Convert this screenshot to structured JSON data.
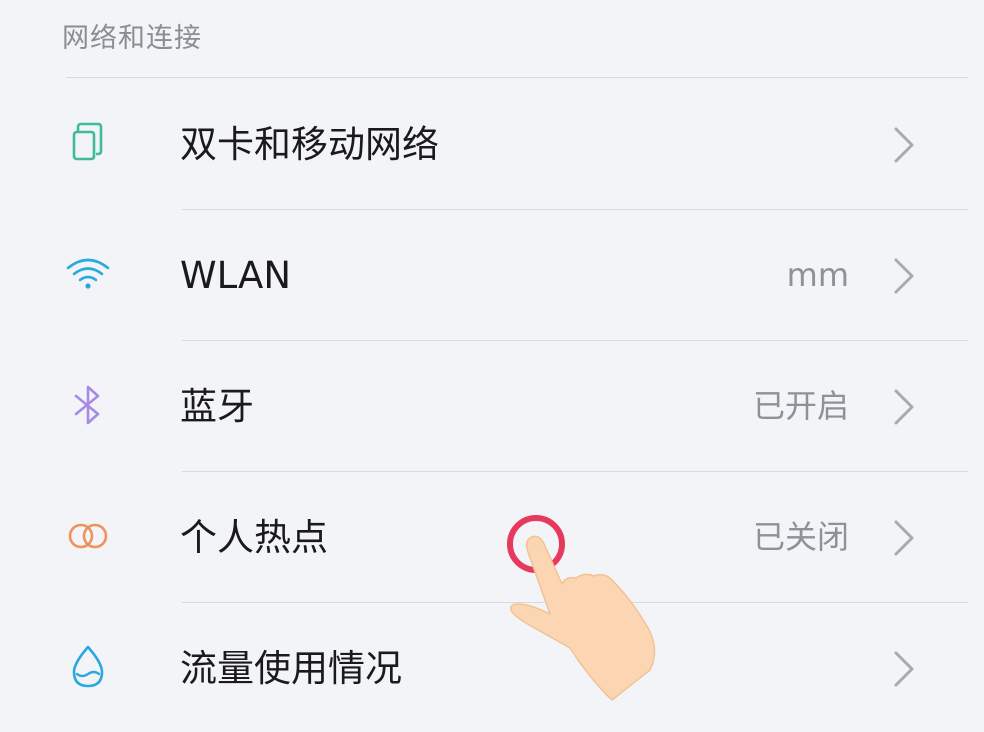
{
  "section": {
    "title": "网络和连接"
  },
  "items": [
    {
      "label": "双卡和移动网络",
      "value": "",
      "icon": "dual-sim-icon",
      "color": "#3dbb9a"
    },
    {
      "label": "WLAN",
      "value": "mm",
      "icon": "wifi-icon",
      "color": "#2aa8e0"
    },
    {
      "label": "蓝牙",
      "value": "已开启",
      "icon": "bluetooth-icon",
      "color": "#a88ae6"
    },
    {
      "label": "个人热点",
      "value": "已关闭",
      "icon": "hotspot-icon",
      "color": "#f0935a"
    },
    {
      "label": "流量使用情况",
      "value": "",
      "icon": "data-usage-icon",
      "color": "#2aa8e0"
    }
  ],
  "colors": {
    "background": "#f2f4f7",
    "chevron": "#a7aaaf",
    "tap_indicator": "#e8385e",
    "hand_skin": "#fcd6b2"
  }
}
